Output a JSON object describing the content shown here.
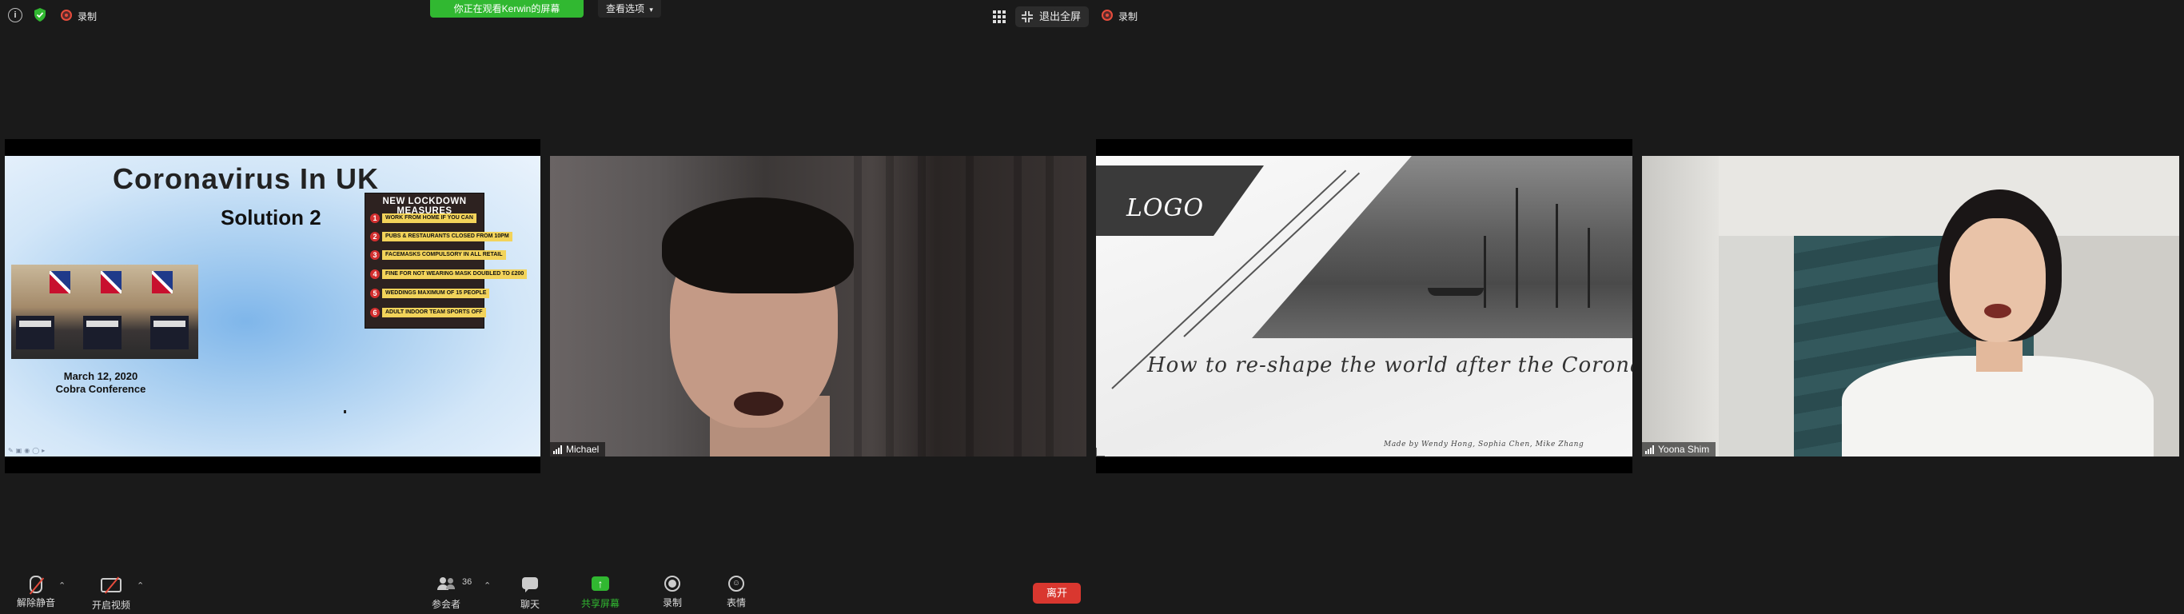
{
  "topbar": {
    "recording_label": "录制",
    "viewing_banner": "你正在观看Kerwin的屏幕",
    "view_options": "查看选项",
    "exit_fullscreen": "退出全屏",
    "right_recording_label": "录制"
  },
  "slide1": {
    "title": "Coronavirus In UK",
    "subtitle": "Solution 2",
    "date": "March 12, 2020",
    "event": "Cobra Conference",
    "measures_title": "NEW LOCKDOWN MEASURES",
    "measures": [
      {
        "num": "1",
        "text": "WORK FROM HOME IF YOU CAN"
      },
      {
        "num": "2",
        "text": "PUBS & RESTAURANTS CLOSED FROM 10PM"
      },
      {
        "num": "3",
        "text": "FACEMASKS COMPULSORY IN ALL RETAIL"
      },
      {
        "num": "4",
        "text": "FINE FOR NOT WEARING MASK DOUBLED TO £200"
      },
      {
        "num": "5",
        "text": "WEDDINGS MAXIMUM OF 15 PEOPLE"
      },
      {
        "num": "6",
        "text": "ADULT INDOOR TEAM SPORTS OFF"
      }
    ]
  },
  "participants": {
    "michael": "Michael",
    "yoona": "Yoona Shim"
  },
  "slide2": {
    "logo": "LOGO",
    "title": "How to re-shape the world after the Coronavirus?",
    "credits": "Made by Wendy Hong, Sophia Chen, Mike Zhang"
  },
  "toolbar": {
    "mute": "解除静音",
    "video": "开启视频",
    "participants": "参会者",
    "participant_count": "36",
    "chat": "聊天",
    "share": "共享屏幕",
    "record": "录制",
    "reactions": "表情",
    "leave": "离开"
  }
}
